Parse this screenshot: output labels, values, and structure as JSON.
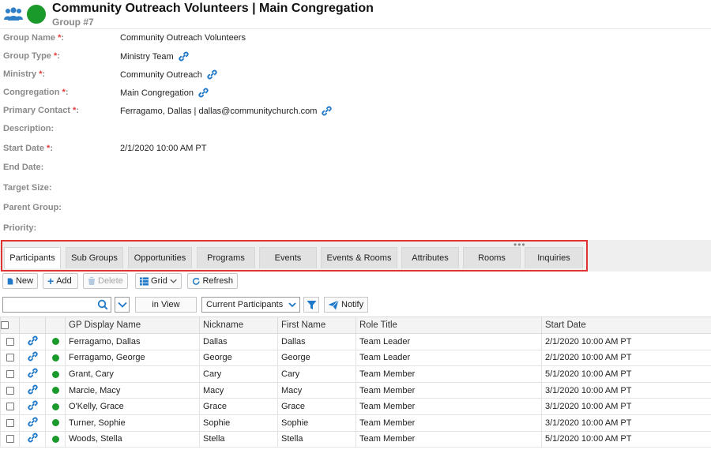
{
  "header": {
    "title": "Community Outreach Volunteers | Main Congregation",
    "subtitle": "Group #7",
    "icon": "group-icon",
    "status_color": "#1a9a2a"
  },
  "fields": {
    "group_name": {
      "label": "Group Name",
      "required": "*",
      "colon": ":",
      "value": "Community Outreach Volunteers"
    },
    "group_type": {
      "label": "Group Type",
      "required": "*",
      "colon": ":",
      "value": "Ministry Team"
    },
    "ministry": {
      "label": "Ministry",
      "required": "*",
      "colon": ":",
      "value": "Community Outreach"
    },
    "congregation": {
      "label": "Congregation",
      "required": "*",
      "colon": ":",
      "value": "Main Congregation"
    },
    "primary_contact": {
      "label": "Primary Contact",
      "required": "*",
      "colon": ":",
      "value": "Ferragamo, Dallas | dallas@communitychurch.com"
    },
    "description": {
      "label": "Description:"
    },
    "start_date": {
      "label": "Start Date",
      "required": "*",
      "colon": ":",
      "value": "2/1/2020 10:00 AM PT"
    },
    "end_date": {
      "label": "End Date:"
    },
    "target_size": {
      "label": "Target Size:"
    },
    "parent_group": {
      "label": "Parent Group:"
    },
    "priority": {
      "label": "Priority:"
    }
  },
  "tabs": [
    "Participants",
    "Sub Groups",
    "Opportunities",
    "Programs",
    "Events",
    "Events & Rooms",
    "Attributes",
    "Rooms",
    "Inquiries"
  ],
  "tabs_more": "•••",
  "toolbar": {
    "new": "New",
    "add": "Add",
    "delete": "Delete",
    "grid": "Grid",
    "refresh": "Refresh"
  },
  "filter": {
    "search_value": "",
    "in_view": "in View",
    "view_select": "Current Participants",
    "notify": "Notify"
  },
  "grid": {
    "columns": [
      "GP Display Name",
      "Nickname",
      "First Name",
      "Role Title",
      "Start Date"
    ],
    "rows": [
      {
        "name": "Ferragamo, Dallas",
        "nickname": "Dallas",
        "first": "Dallas",
        "role": "Team Leader",
        "start": "2/1/2020 10:00 AM PT"
      },
      {
        "name": "Ferragamo, George",
        "nickname": "George",
        "first": "George",
        "role": "Team Leader",
        "start": "2/1/2020 10:00 AM PT"
      },
      {
        "name": "Grant, Cary",
        "nickname": "Cary",
        "first": "Cary",
        "role": "Team Member",
        "start": "5/1/2020 10:00 AM PT"
      },
      {
        "name": "Marcie, Macy",
        "nickname": "Macy",
        "first": "Macy",
        "role": "Team Member",
        "start": "3/1/2020 10:00 AM PT"
      },
      {
        "name": "O'Kelly, Grace",
        "nickname": "Grace",
        "first": "Grace",
        "role": "Team Member",
        "start": "3/1/2020 10:00 AM PT"
      },
      {
        "name": "Turner, Sophie",
        "nickname": "Sophie",
        "first": "Sophie",
        "role": "Team Member",
        "start": "3/1/2020 10:00 AM PT"
      },
      {
        "name": "Woods, Stella",
        "nickname": "Stella",
        "first": "Stella",
        "role": "Team Member",
        "start": "5/1/2020 10:00 AM PT"
      }
    ]
  },
  "colors": {
    "accent": "#1f78c8",
    "required": "#e03a3a",
    "status_active": "#1a9a2a",
    "highlight_border": "#e23333"
  }
}
